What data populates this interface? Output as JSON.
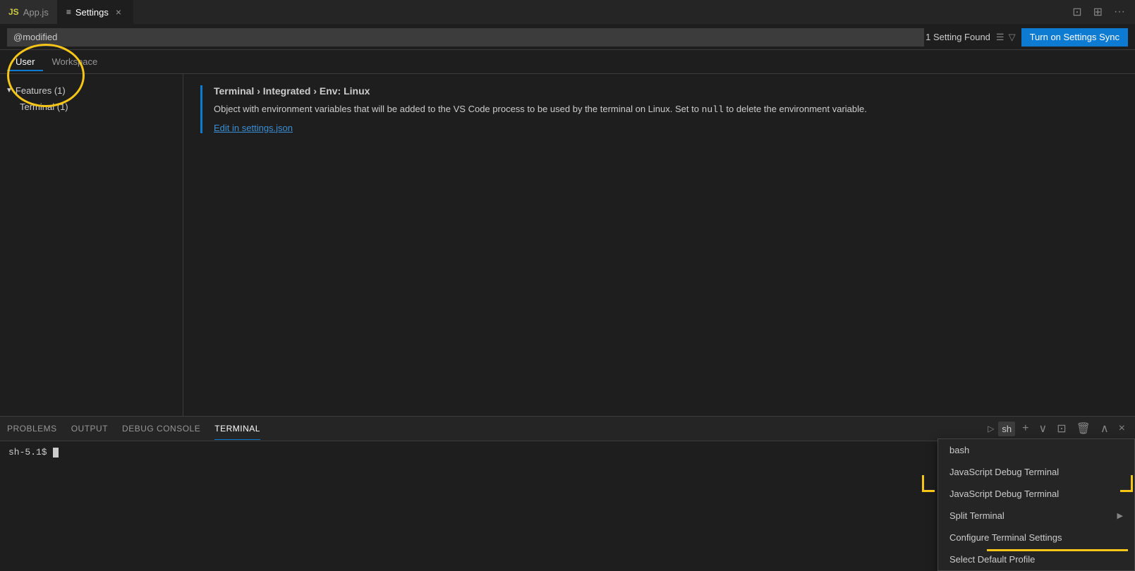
{
  "tabs": [
    {
      "id": "app-js",
      "label": "App.js",
      "icon": "JS",
      "active": false
    },
    {
      "id": "settings",
      "label": "Settings",
      "icon": "≡",
      "active": true
    }
  ],
  "tab_actions": {
    "split_editor": "⊡",
    "toggle_layout": "⊞",
    "more": "···"
  },
  "settings": {
    "search_value": "@modified",
    "found_label": "1 Setting Found",
    "sync_button": "Turn on Settings Sync",
    "user_tab": "User",
    "workspace_tab": "Workspace",
    "active_tab": "user"
  },
  "sidebar": {
    "features_section": "Features (1)",
    "terminal_item": "Terminal (1)"
  },
  "setting_item": {
    "title": "Terminal › Integrated › Env: Linux",
    "description": "Object with environment variables that will be added to the VS Code process to be used by the terminal on Linux. Set to ",
    "null_code": "null",
    "description2": " to delete the environment variable.",
    "link_text": "Edit in settings.json"
  },
  "terminal_panel": {
    "tabs": [
      "PROBLEMS",
      "OUTPUT",
      "DEBUG CONSOLE",
      "TERMINAL"
    ],
    "active_tab": "TERMINAL",
    "shell_label": "sh",
    "prompt": "sh-5.1$"
  },
  "dropdown_menu": {
    "items": [
      {
        "id": "bash",
        "label": "bash",
        "has_submenu": false
      },
      {
        "id": "js-debug-terminal-1",
        "label": "JavaScript Debug Terminal",
        "has_submenu": false
      },
      {
        "id": "js-debug-terminal-2",
        "label": "JavaScript Debug Terminal",
        "has_submenu": false
      },
      {
        "id": "split-terminal",
        "label": "Split Terminal",
        "has_submenu": true
      },
      {
        "id": "configure-terminal-settings",
        "label": "Configure Terminal Settings",
        "has_submenu": false
      },
      {
        "id": "select-default-profile",
        "label": "Select Default Profile",
        "has_submenu": false
      }
    ]
  }
}
